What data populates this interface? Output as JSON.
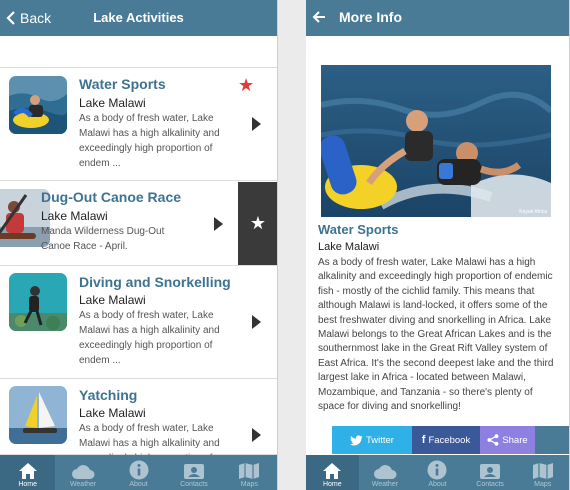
{
  "left_screen": {
    "header": {
      "back_label": "Back",
      "title": "Lake Activities"
    },
    "items": [
      {
        "title": "Water Sports",
        "location": "Lake Malawi",
        "desc": "As a body of fresh water, Lake Malawi has a high alkalinity and exceedingly high proportion of endem ...",
        "favorite": true
      },
      {
        "title": "Dug-Out Canoe Race",
        "location": "Lake Malawi",
        "desc": "Manda Wilderness Dug-Out Canoe Race - April.",
        "favorite_action": true
      },
      {
        "title": "Diving and Snorkelling",
        "location": "Lake Malawi",
        "desc": "As a body of fresh water, Lake Malawi has a high alkalinity and exceedingly high proportion of endem ..."
      },
      {
        "title": "Yatching",
        "location": "Lake Malawi",
        "desc": "As a body of fresh water, Lake Malawi has a high alkalinity and exceedingly high proportion of endem ..."
      }
    ],
    "tabs": [
      "Home",
      "Weather",
      "About",
      "Contacts",
      "Maps"
    ],
    "active_tab": "Home"
  },
  "right_screen": {
    "header": {
      "title": "More Info"
    },
    "detail": {
      "title": "Water Sports",
      "location": "Lake Malawi",
      "body": "As a body of fresh water, Lake Malawi has a high alkalinity and exceedingly high proportion of endemic fish - mostly of the cichlid family. This means that although Malawi is land-locked, it offers some of the best freshwater diving and snorkelling in Africa. Lake Malawi belongs to the Great African Lakes and is the southernmost lake in the Great Rift Valley system of East Africa. It's the second deepest lake and the third largest lake in Africa - located between Malawi, Mozambique, and Tanzania - so there's plenty of space for diving and snorkelling!",
      "image_caption": "Kayak Africa"
    },
    "share": {
      "twitter": "Twitter",
      "facebook": "Facebook",
      "share": "Share"
    },
    "tabs": [
      "Home",
      "Weather",
      "About",
      "Contacts",
      "Maps"
    ],
    "active_tab": "Home"
  },
  "colors": {
    "header": "#4a7b96",
    "title_accent": "#3d7391",
    "favorite_star": "#e03b3b",
    "twitter": "#2fb0e6",
    "facebook": "#3b5998",
    "share": "#8e80e0"
  },
  "icons": {
    "back": "arrow-left-icon",
    "favorite": "star-icon",
    "chevron": "chevron-right-icon",
    "home": "home-icon",
    "weather": "cloud-icon",
    "about": "info-icon",
    "contacts": "contacts-icon",
    "maps": "map-icon"
  }
}
